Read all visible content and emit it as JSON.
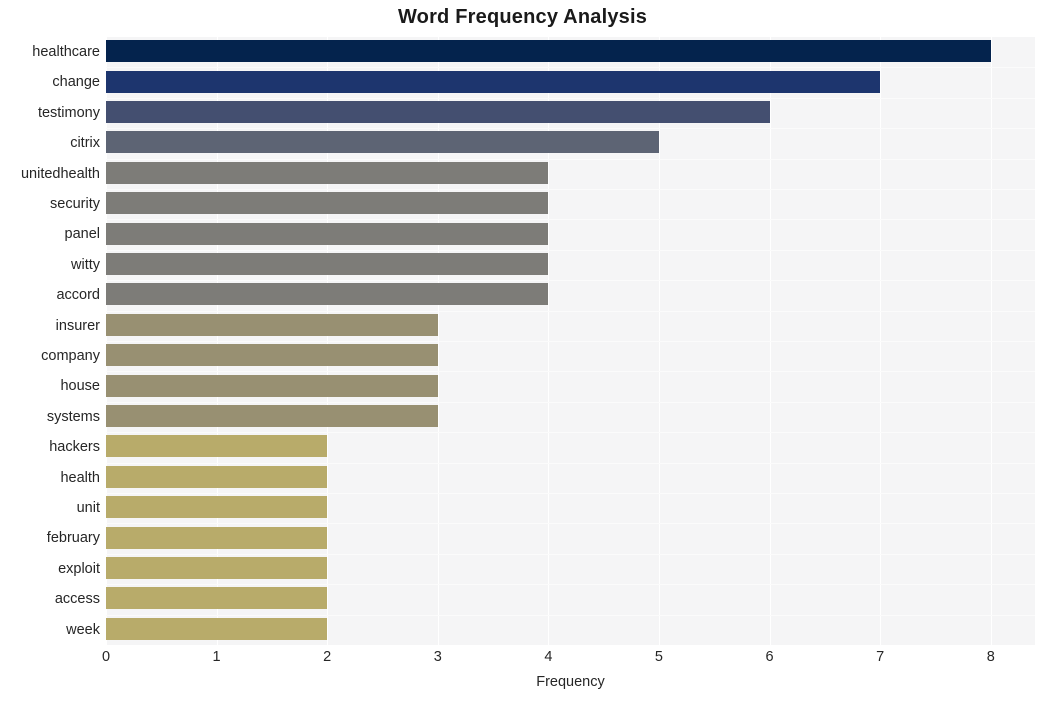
{
  "chart_data": {
    "type": "bar",
    "orientation": "horizontal",
    "title": "Word Frequency Analysis",
    "xlabel": "Frequency",
    "ylabel": "",
    "xlim": [
      0,
      8.4
    ],
    "xticks": [
      "0",
      "1",
      "2",
      "3",
      "4",
      "5",
      "6",
      "7",
      "8"
    ],
    "xtick_values": [
      0,
      1,
      2,
      3,
      4,
      5,
      6,
      7,
      8
    ],
    "grid": true,
    "legend": "none",
    "categories": [
      "healthcare",
      "change",
      "testimony",
      "citrix",
      "unitedhealth",
      "security",
      "panel",
      "witty",
      "accord",
      "insurer",
      "company",
      "house",
      "systems",
      "hackers",
      "health",
      "unit",
      "february",
      "exploit",
      "access",
      "week"
    ],
    "values": [
      8,
      7,
      6,
      5,
      4,
      4,
      4,
      4,
      4,
      3,
      3,
      3,
      3,
      2,
      2,
      2,
      2,
      2,
      2,
      2
    ],
    "bar_colors": [
      "#04234d",
      "#1d356e",
      "#444f70",
      "#5d6474",
      "#7d7c78",
      "#7d7c78",
      "#7d7c78",
      "#7d7c78",
      "#7d7c78",
      "#989072",
      "#989072",
      "#989072",
      "#989072",
      "#b8ab6a",
      "#b8ab6a",
      "#b8ab6a",
      "#b8ab6a",
      "#b8ab6a",
      "#b8ab6a",
      "#b8ab6a"
    ],
    "plot_background": "#f5f5f6",
    "figure_background": "#ffffff",
    "gridline_color": "#ffffff"
  }
}
